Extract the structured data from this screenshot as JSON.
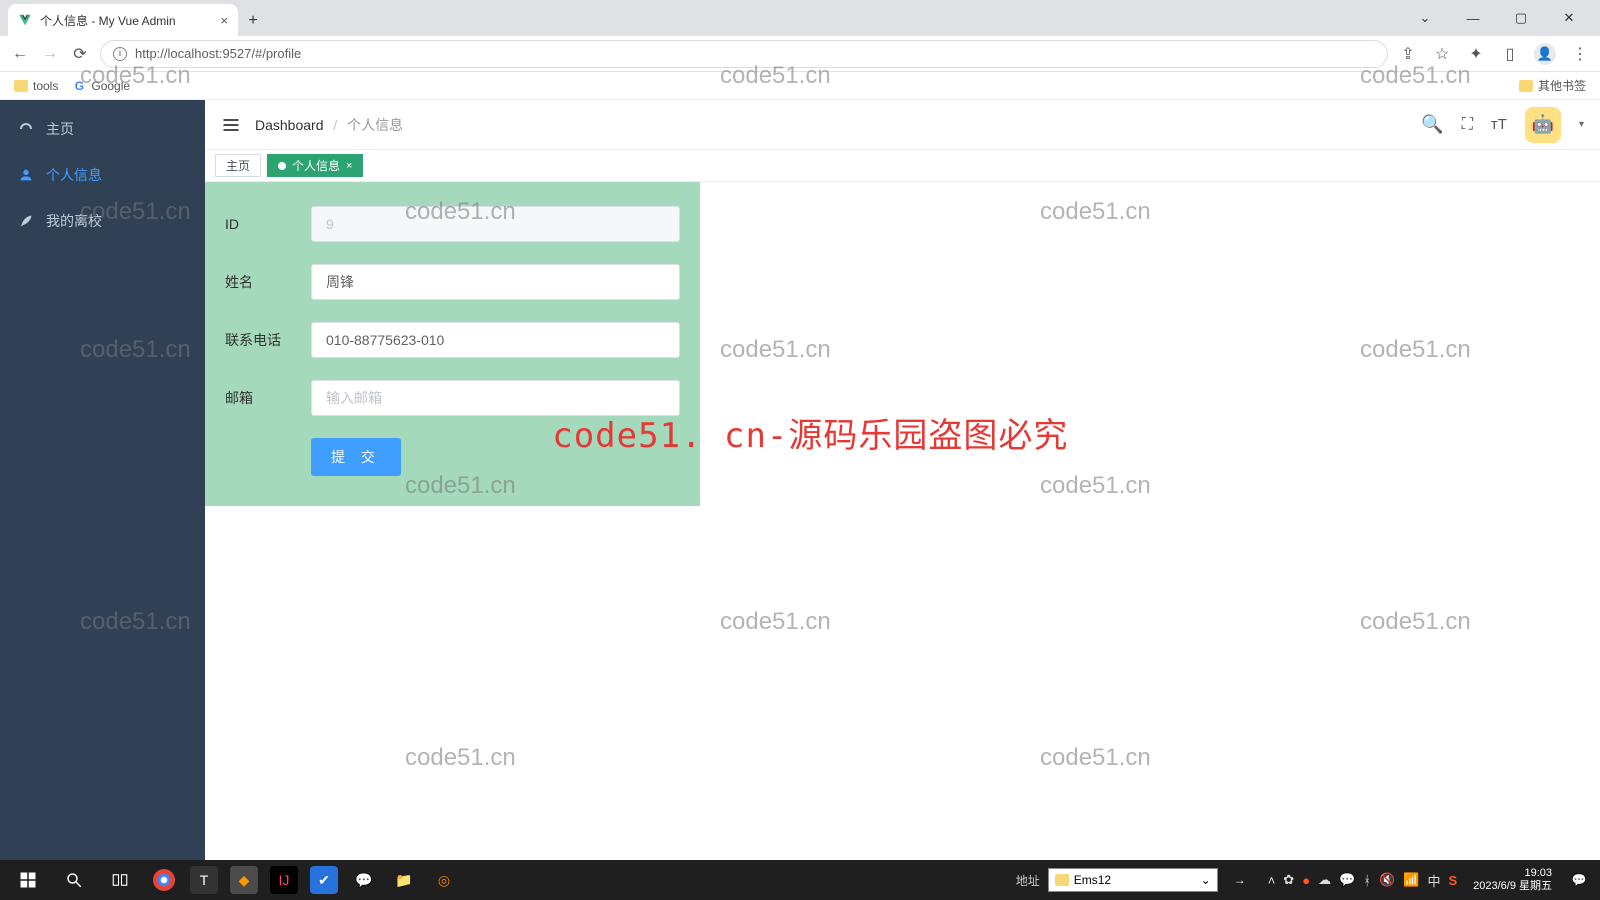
{
  "browser": {
    "tab_title": "个人信息 - My Vue Admin",
    "url": "http://localhost:9527/#/profile",
    "bookmarks": {
      "tools": "tools",
      "google": "Google",
      "other": "其他书签"
    }
  },
  "sidebar": {
    "items": [
      {
        "label": "主页"
      },
      {
        "label": "个人信息"
      },
      {
        "label": "我的离校"
      }
    ]
  },
  "topbar": {
    "crumb_root": "Dashboard",
    "crumb_current": "个人信息"
  },
  "tabs": {
    "home": "主页",
    "profile": "个人信息"
  },
  "form": {
    "id_label": "ID",
    "id_value": "9",
    "name_label": "姓名",
    "name_value": "周锋",
    "phone_label": "联系电话",
    "phone_value": "010-88775623-010",
    "email_label": "邮箱",
    "email_placeholder": "输入邮箱",
    "email_value": "",
    "submit_label": "提 交"
  },
  "watermark": {
    "text": "code51.cn",
    "banner": "code51. cn-源码乐园盗图必究"
  },
  "taskbar": {
    "addr_label": "地址",
    "path_value": "Ems12",
    "time": "19:03",
    "date": "2023/6/9 星期五"
  }
}
